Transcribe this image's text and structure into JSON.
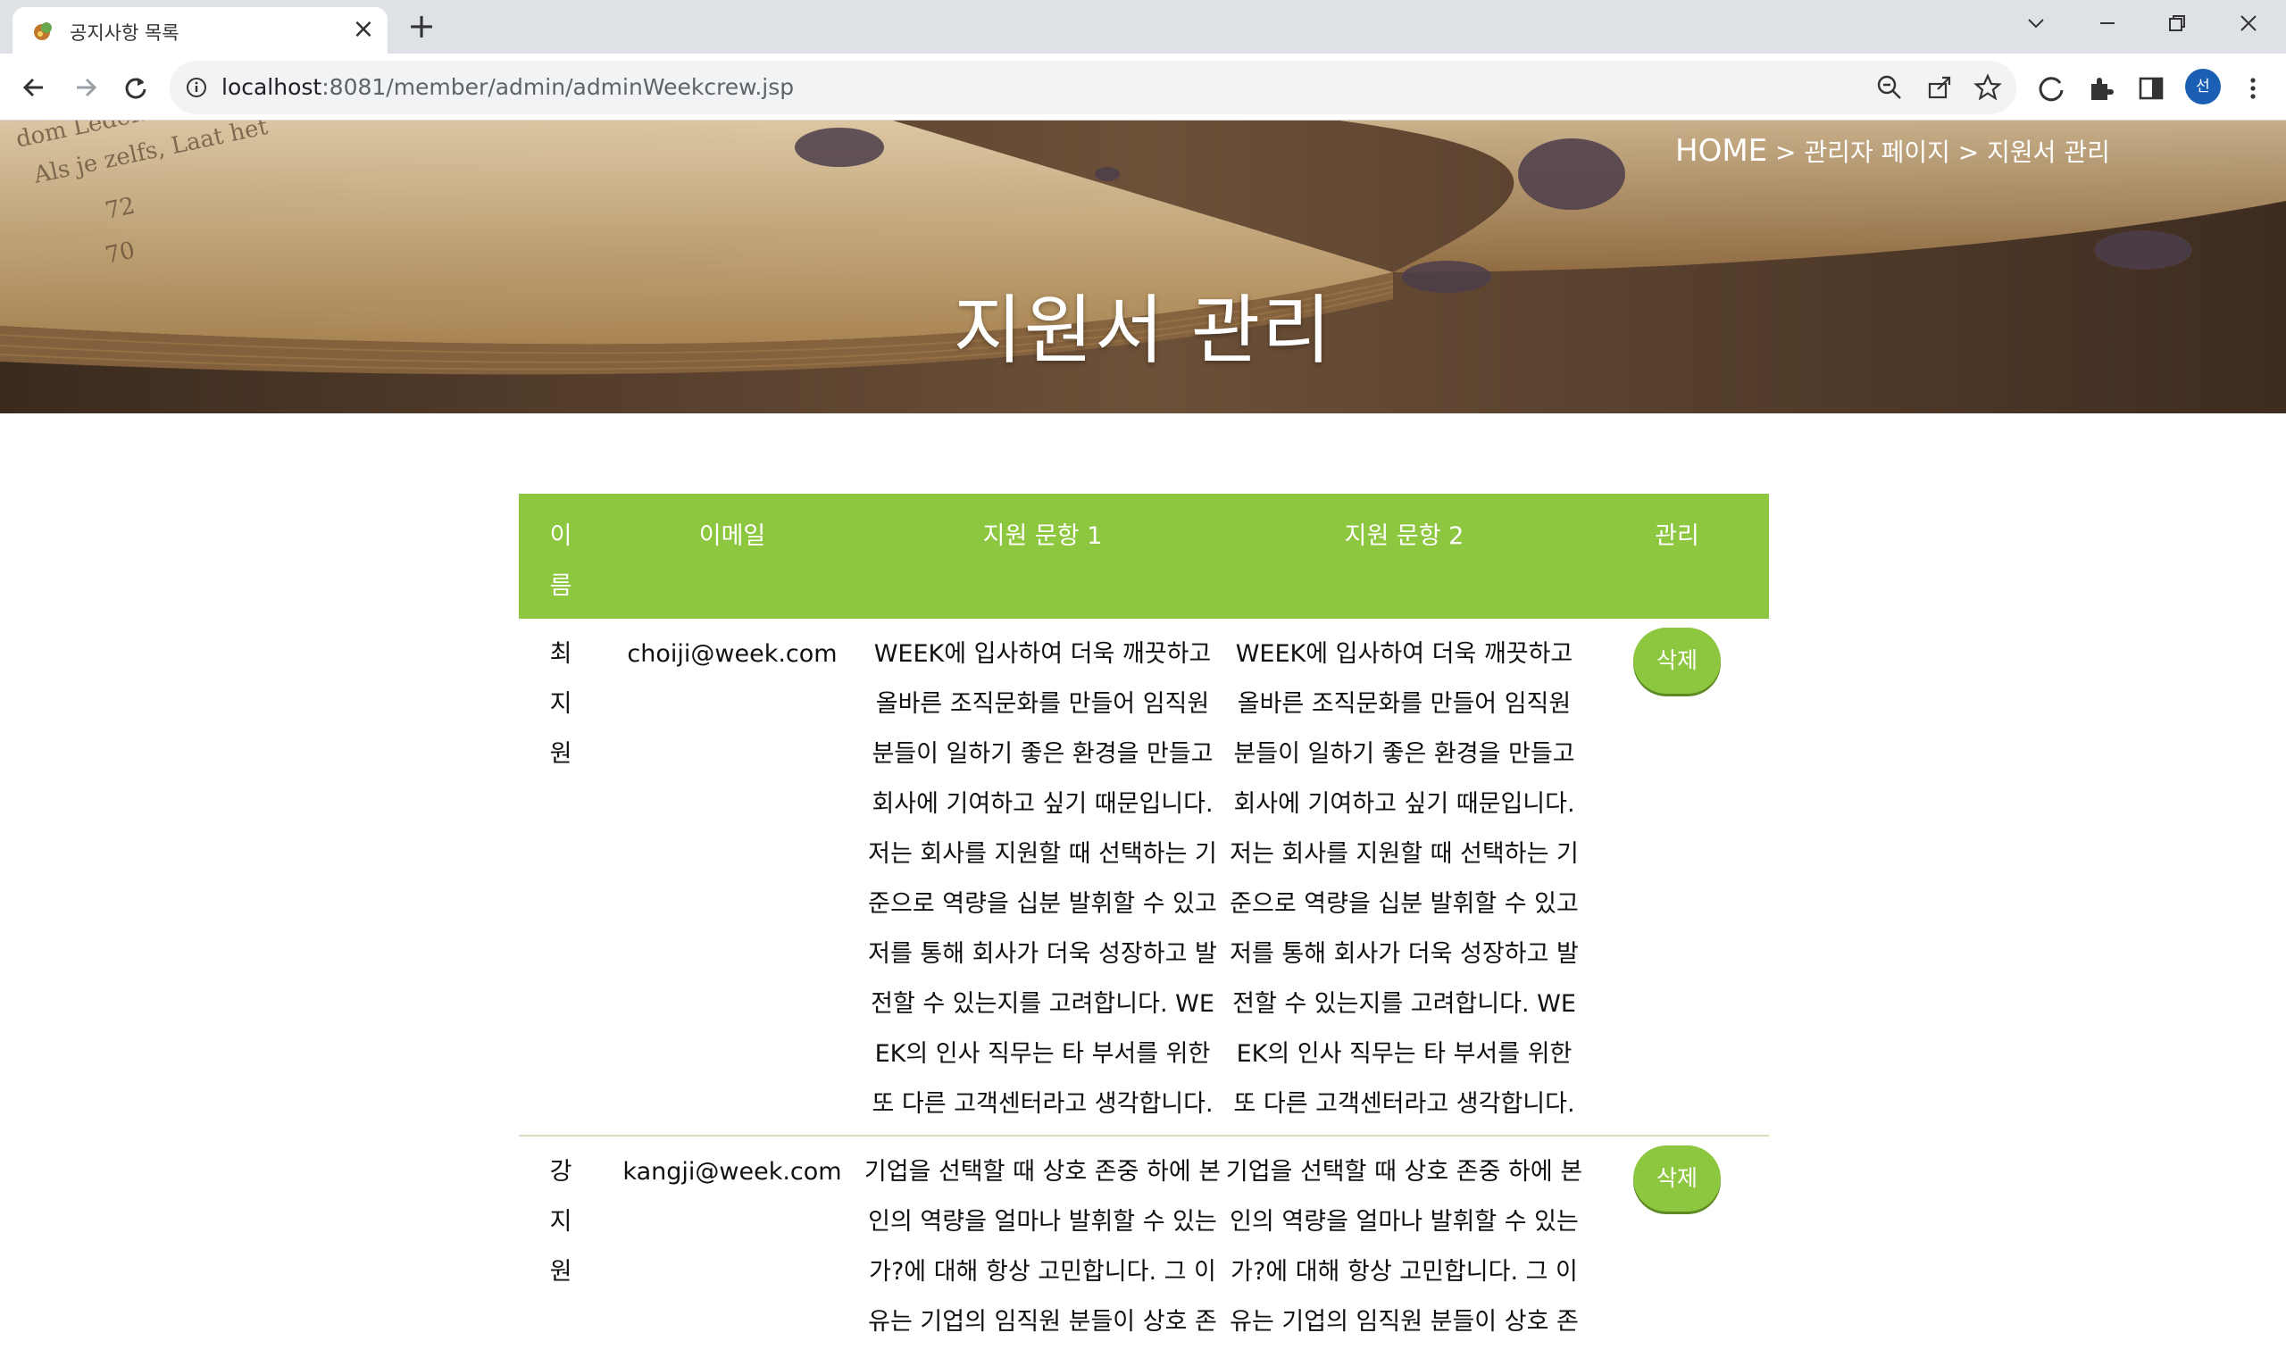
{
  "browser": {
    "tab_title": "공지사항 목록",
    "url_host": "localhost",
    "url_rest": ":8081/member/admin/adminWeekcrew.jsp",
    "avatar_initial": "선"
  },
  "banner": {
    "breadcrumb_home": "HOME",
    "breadcrumb_rest": " > 관리자 페이지 > 지원서 관리",
    "title": "지원서 관리"
  },
  "table": {
    "headers": [
      "이름",
      "이메일",
      "지원 문항 1",
      "지원 문항 2",
      "관리"
    ],
    "rows": [
      {
        "name": "최지원",
        "email": "choiji@week.com",
        "q1": "WEEK에 입사하여 더욱 깨끗하고 올바른 조직문화를 만들어 임직원 분들이 일하기 좋은 환경을 만들고 회사에 기여하고 싶기 때문입니다. 저는 회사를 지원할 때 선택하는 기준으로 역량을 십분 발휘할 수 있고 저를 통해 회사가 더욱 성장하고 발전할 수 있는지를 고려합니다. WEEK의 인사 직무는 타 부서를 위한 또 다른 고객센터라고 생각합니다.",
        "q2": "WEEK에 입사하여 더욱 깨끗하고 올바른 조직문화를 만들어 임직원 분들이 일하기 좋은 환경을 만들고 회사에 기여하고 싶기 때문입니다. 저는 회사를 지원할 때 선택하는 기준으로 역량을 십분 발휘할 수 있고 저를 통해 회사가 더욱 성장하고 발전할 수 있는지를 고려합니다. WEEK의 인사 직무는 타 부서를 위한 또 다른 고객센터라고 생각합니다.",
        "action": "삭제"
      },
      {
        "name": "강지원",
        "email": "kangji@week.com",
        "q1": "기업을 선택할 때 상호 존중 하에 본인의 역량을 얼마나 발휘할 수 있는 가?에 대해 항상 고민합니다. 그 이유는 기업의 임직원 분들이 상호 존",
        "q2": "기업을 선택할 때 상호 존중 하에 본인의 역량을 얼마나 발휘할 수 있는 가?에 대해 항상 고민합니다. 그 이유는 기업의 임직원 분들이 상호 존",
        "action": "삭제"
      }
    ]
  },
  "colors": {
    "accent": "#8dc63f",
    "chrome_tabbar": "#dee1e6",
    "omnibox": "#f1f3f4"
  },
  "icons": [
    "back-arrow-icon",
    "forward-arrow-icon",
    "reload-icon",
    "info-icon",
    "zoom-icon",
    "share-icon",
    "star-icon",
    "refresh-icon",
    "extensions-icon",
    "sidepanel-icon",
    "menu-dots-icon",
    "minimize-icon",
    "restore-icon",
    "close-window-icon",
    "tab-search-icon"
  ]
}
